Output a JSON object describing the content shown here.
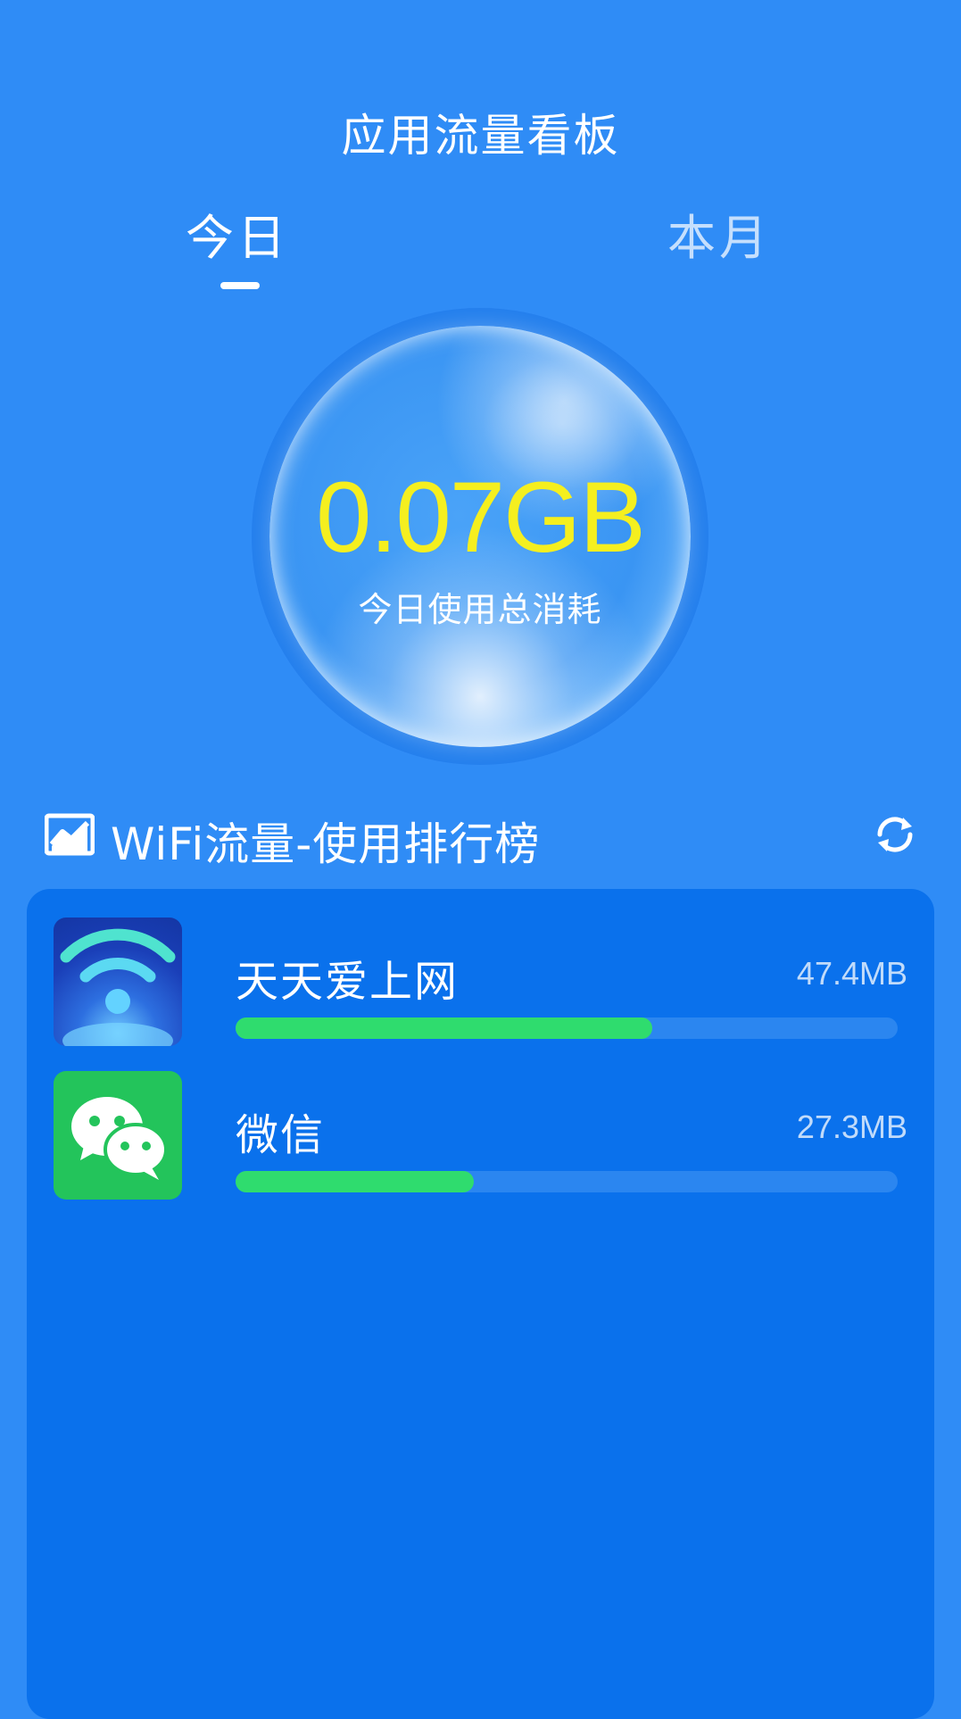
{
  "header": {
    "title": "应用流量看板"
  },
  "tabs": [
    {
      "label": "今日",
      "active": true
    },
    {
      "label": "本月",
      "active": false
    }
  ],
  "summary": {
    "total": "0.07GB",
    "label": "今日使用总消耗"
  },
  "ranking": {
    "title": "WiFi流量-使用排行榜",
    "apps": [
      {
        "name": "天天爱上网",
        "size": "47.4MB",
        "usage_fraction": 0.63,
        "icon": "wifi-app-icon"
      },
      {
        "name": "微信",
        "size": "27.3MB",
        "usage_fraction": 0.36,
        "icon": "wechat-icon"
      }
    ]
  },
  "colors": {
    "background": "#2f8cf6",
    "panel": "#0a71ec",
    "total_value": "#f5ef1f",
    "bar_fill": "#2fdc6e",
    "bar_track": "#2b86f0",
    "wechat_green": "#23c45b"
  }
}
